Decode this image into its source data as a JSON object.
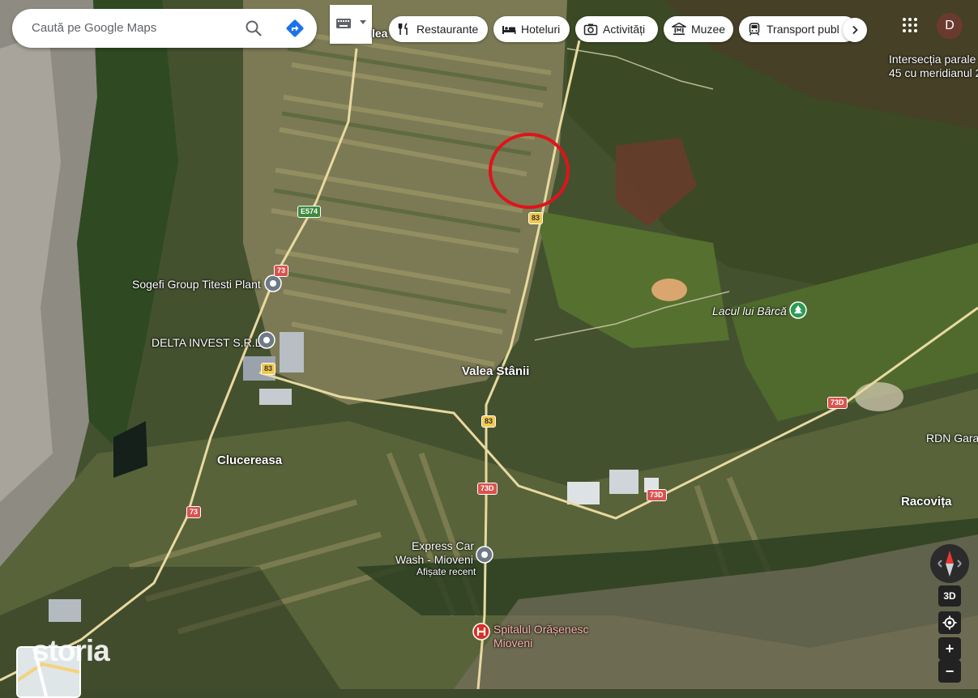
{
  "search": {
    "placeholder": "Caută pe Google Maps"
  },
  "chips": [
    {
      "label": "Restaurante",
      "icon": "fork-knife-icon"
    },
    {
      "label": "Hoteluri",
      "icon": "bed-icon"
    },
    {
      "label": "Activități",
      "icon": "camera-icon"
    },
    {
      "label": "Muzee",
      "icon": "museum-icon"
    },
    {
      "label": "Transport publ",
      "icon": "train-icon"
    }
  ],
  "account": {
    "initial": "D"
  },
  "map_labels": {
    "partial_top": "lea",
    "intersection_line1": "Intersecția parale",
    "intersection_line2": "45 cu meridianul 2",
    "sogefi": "Sogefi Group Titesti Plant",
    "delta": "DELTA INVEST S.R.L",
    "valea": "Valea Stânii",
    "lacul": "Lacul lui Bârcă",
    "clucereasa": "Clucereasa",
    "rdn": "RDN Garag",
    "racovita": "Racovița",
    "express_line1": "Express Car",
    "express_line2": "Wash - Mioveni",
    "express_sub": "Afișate recent",
    "spital_line1": "Spitalul Orășenesc",
    "spital_line2": "Mioveni"
  },
  "road_badges": {
    "e574": "E574",
    "r83_a": "83",
    "r73_a": "73",
    "r83_b": "83",
    "r83_c": "83",
    "r73d_a": "73D",
    "r73d_b": "73D",
    "r73d_c": "73D",
    "r73_b": "73"
  },
  "controls": {
    "three_d": "3D",
    "zoom_in": "+",
    "zoom_out": "−"
  },
  "watermark": "storia",
  "colors": {
    "highlight_circle": "#e0131b",
    "hospital_pin": "#d93025",
    "park_pin": "#2e9b55",
    "place_pin": "#6e7a86"
  }
}
